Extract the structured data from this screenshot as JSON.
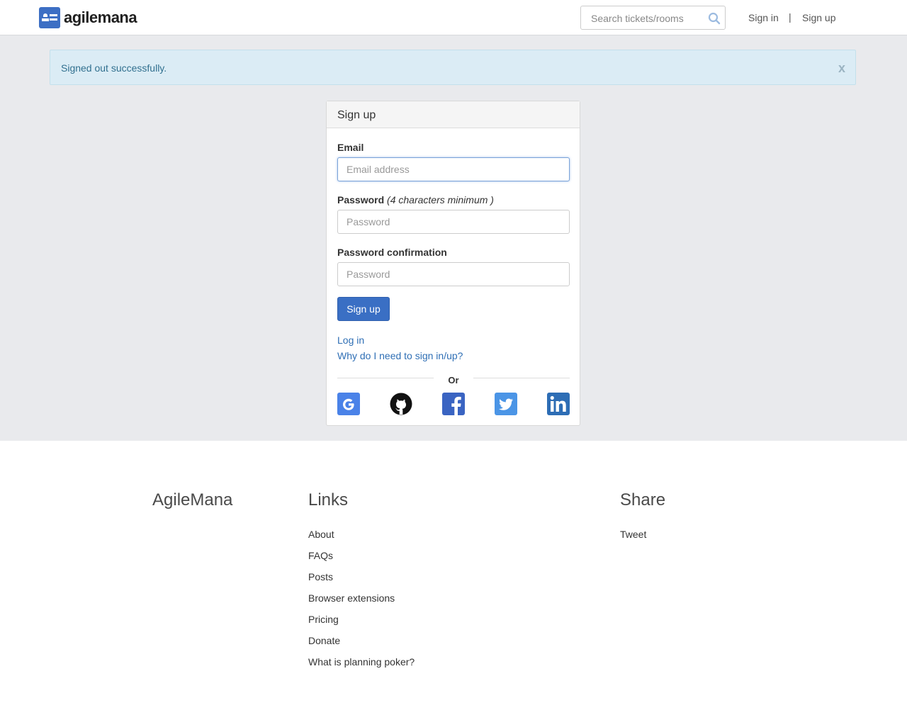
{
  "header": {
    "brand": "agilemana",
    "search_placeholder": "Search tickets/rooms",
    "sign_in": "Sign in",
    "separator": "|",
    "sign_up": "Sign up"
  },
  "alert": {
    "message": "Signed out successfully.",
    "close": "x"
  },
  "form": {
    "title": "Sign up",
    "email_label": "Email",
    "email_placeholder": "Email address",
    "password_label": "Password",
    "password_hint": "(4 characters minimum )",
    "password_placeholder": "Password",
    "confirm_label": "Password confirmation",
    "confirm_placeholder": "Password",
    "submit": "Sign up",
    "log_in": "Log in",
    "why": "Why do I need to sign in/up?",
    "or": "Or"
  },
  "social": [
    "google-icon",
    "github-icon",
    "facebook-icon",
    "twitter-icon",
    "linkedin-icon"
  ],
  "colors": {
    "primary": "#3a6fc4",
    "alert_bg": "#dbecf5",
    "alert_text": "#31708f",
    "band_bg": "#e9eaed",
    "link": "#2f6fb5"
  },
  "footer": {
    "brand": "AgileMana",
    "links_heading": "Links",
    "links": [
      "About",
      "FAQs",
      "Posts",
      "Browser extensions",
      "Pricing",
      "Donate",
      "What is planning poker?"
    ],
    "share_heading": "Share",
    "share_link": "Tweet"
  }
}
